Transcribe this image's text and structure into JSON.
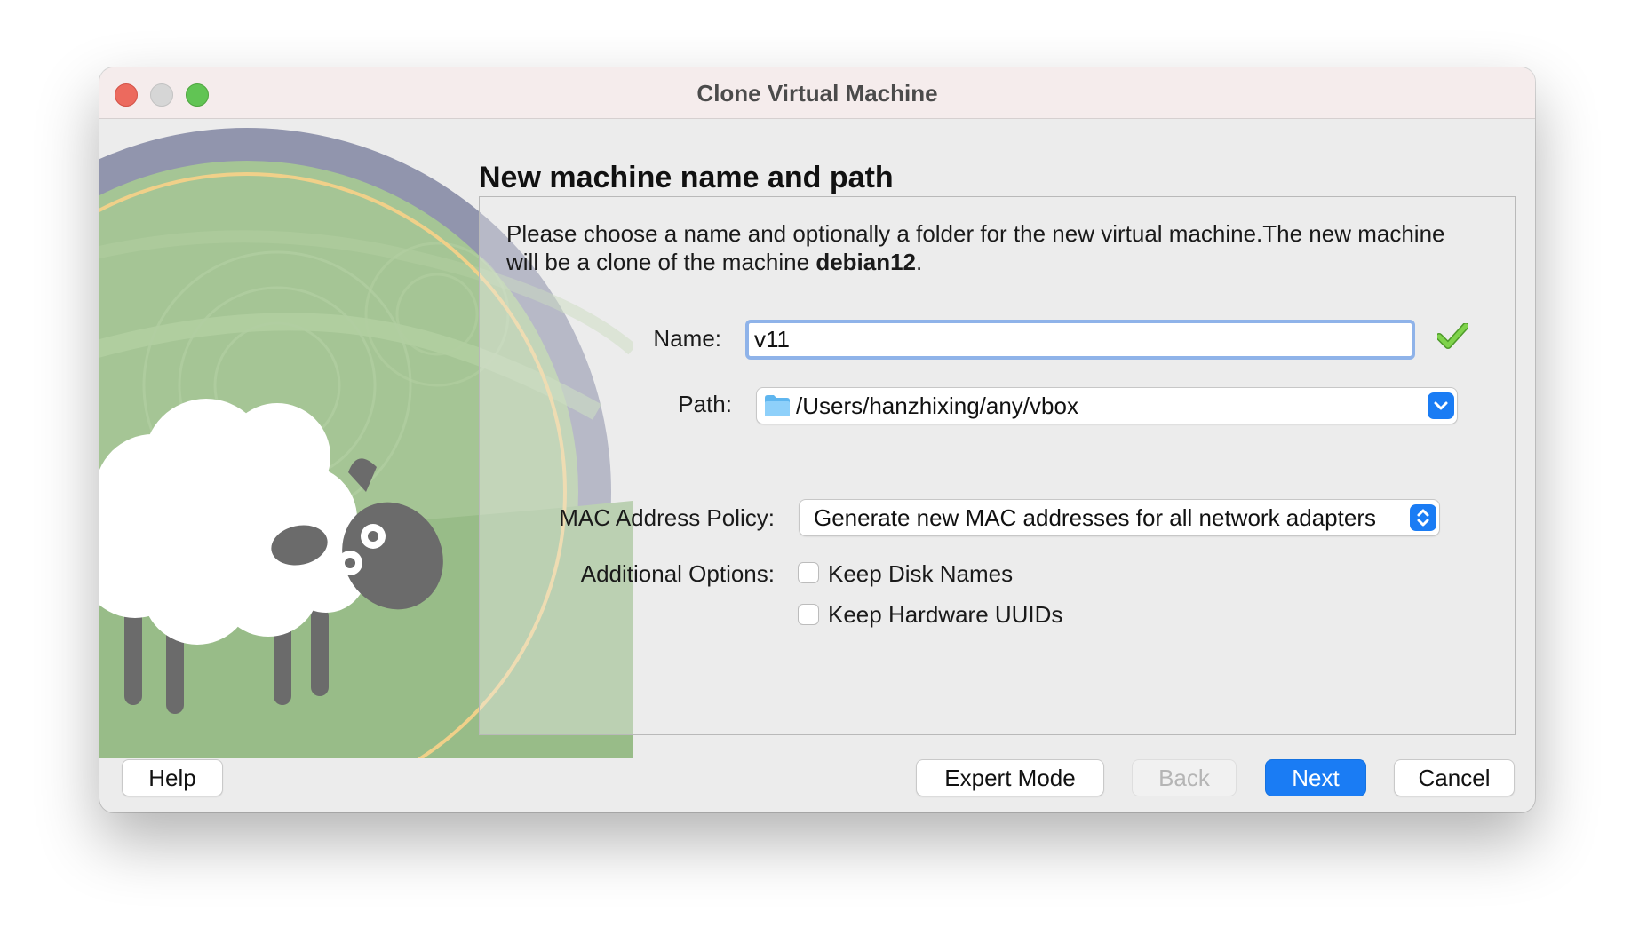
{
  "window": {
    "title": "Clone Virtual Machine"
  },
  "page": {
    "heading": "New machine name and path",
    "description_pre": "Please choose a name and optionally a folder for the new virtual machine.The new machine will be a clone of the machine ",
    "source_machine": "debian12",
    "description_post": "."
  },
  "form": {
    "name_label": "Name:",
    "name_value": "v11",
    "path_label": "Path:",
    "path_value": "/Users/hanzhixing/any/vbox",
    "mac_label": "MAC Address Policy:",
    "mac_value": "Generate new MAC addresses for all network adapters",
    "options_label": "Additional Options:",
    "options": [
      {
        "label": "Keep Disk Names",
        "checked": false
      },
      {
        "label": "Keep Hardware UUIDs",
        "checked": false
      }
    ]
  },
  "buttons": {
    "help": "Help",
    "expert": "Expert Mode",
    "back": "Back",
    "next": "Next",
    "cancel": "Cancel"
  },
  "colors": {
    "accent": "#1a7cf4",
    "valid_check": "#6cc23d",
    "panel_border": "#b9b9b9"
  },
  "icons": [
    "close-icon",
    "minimize-icon",
    "zoom-icon",
    "valid-check-icon",
    "folder-icon",
    "chevron-down-icon",
    "up-down-stepper-icon",
    "sheep-illustration"
  ]
}
